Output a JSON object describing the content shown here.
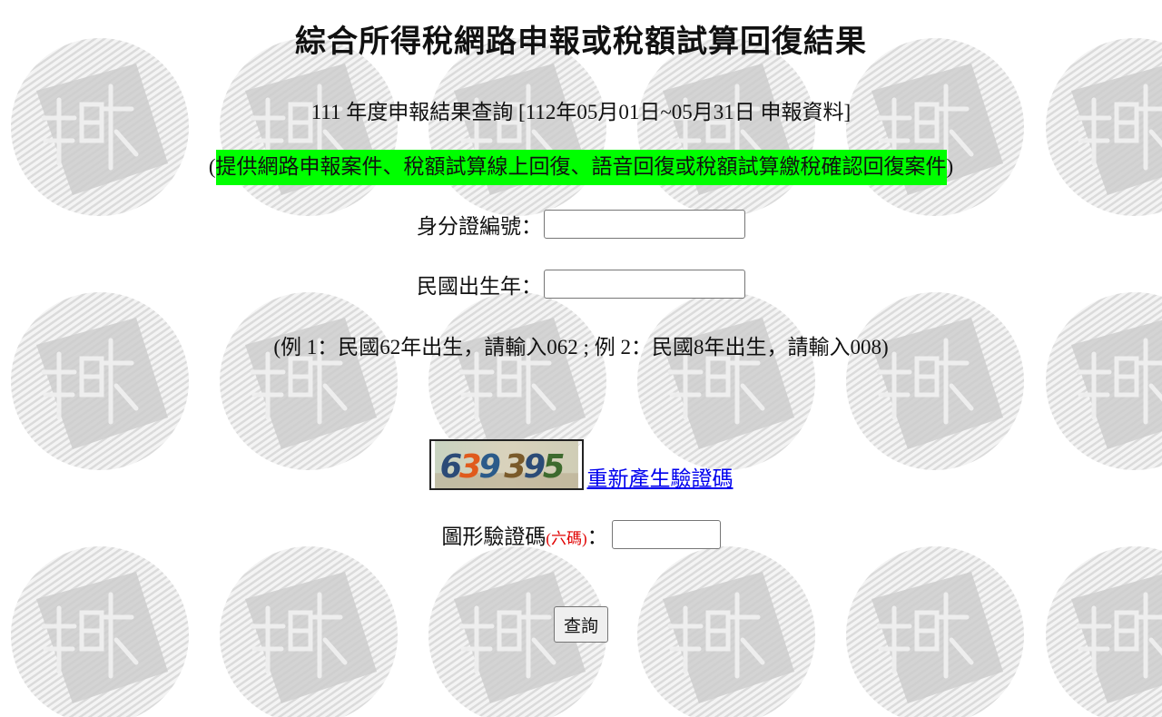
{
  "page": {
    "title": "綜合所得稅網路申報或稅額試算回復結果",
    "subtitle": "111 年度申報結果查詢 [112年05月01日~05月31日 申報資料]",
    "notice_open": "(",
    "notice_text": "提供網路申報案件、稅額試算線上回復、語音回復或稅額試算繳稅確認回復案件",
    "notice_close": ")",
    "notice_highlight_color": "#00ff00"
  },
  "form": {
    "id_label": "身分證編號：",
    "id_value": "",
    "birth_year_label": "民國出生年：",
    "birth_year_value": "",
    "example_text": "(例 1：民國62年出生，請輸入062 ; 例 2：民國8年出生，請輸入008)",
    "captcha": {
      "image_text": "639395",
      "image_digits": [
        "6",
        "3",
        "9",
        "3",
        "9",
        "5"
      ],
      "refresh_link": "重新產生驗證碼",
      "label": "圖形驗證碼",
      "label_note": "(六碼)",
      "label_colon": "：",
      "value": ""
    },
    "submit_label": "查詢"
  }
}
